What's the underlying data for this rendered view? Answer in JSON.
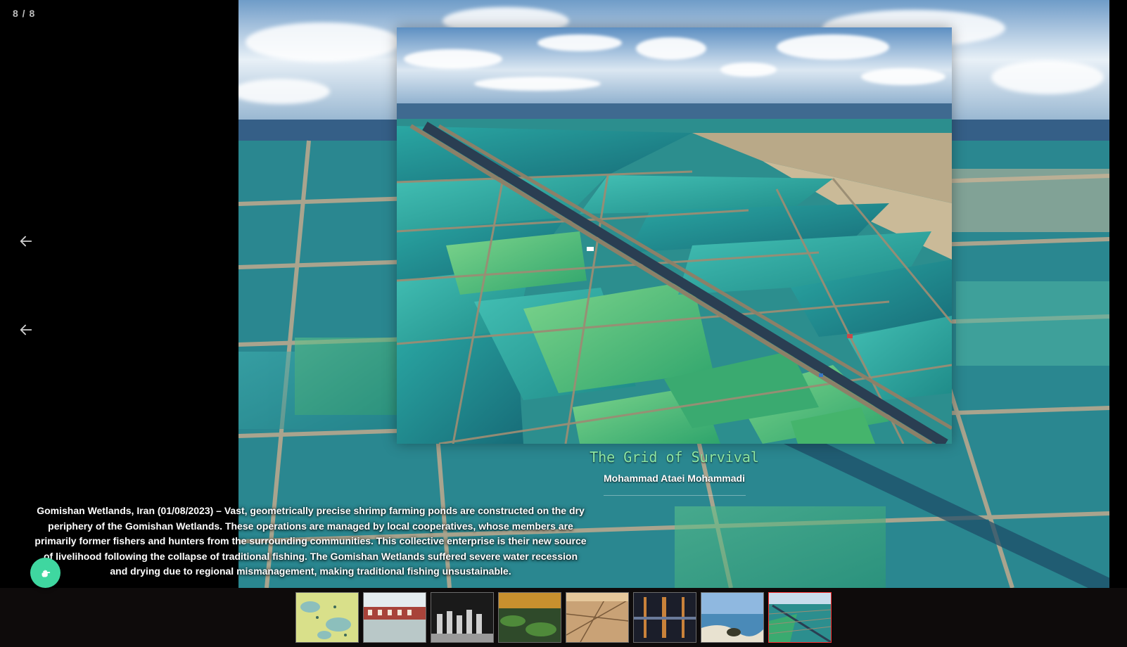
{
  "counter": "8 / 8",
  "icons": {
    "prev_arrow": "arrow-left-icon",
    "prev_arrow_secondary": "arrow-left-icon",
    "fab": "hand-pointer-icon"
  },
  "photo": {
    "title": "The Grid of Survival",
    "author": "Mohammad Ataei Mohammadi",
    "caption": "Gomishan Wetlands, Iran (01/08/2023) – Vast, geometrically precise shrimp farming ponds are constructed on the dry periphery of the Gomishan Wetlands. These operations are managed by local cooperatives, whose members are primarily former fishers and hunters from the surrounding communities. This collective enterprise is their new source of livelihood following the collapse of traditional fishing. The Gomishan Wetlands suffered severe water recession and drying due to regional mismanagement, making traditional fishing unsustainable."
  },
  "colors": {
    "title": "#8ee6a2",
    "fab": "#3fd7a0",
    "active_thumb_border": "#ff3030",
    "strip_bg": "#0e0b0b"
  },
  "thumbnails": [
    {
      "id": 1,
      "active": false
    },
    {
      "id": 2,
      "active": false
    },
    {
      "id": 3,
      "active": false
    },
    {
      "id": 4,
      "active": false
    },
    {
      "id": 5,
      "active": false
    },
    {
      "id": 6,
      "active": false
    },
    {
      "id": 7,
      "active": false
    },
    {
      "id": 8,
      "active": true
    }
  ]
}
